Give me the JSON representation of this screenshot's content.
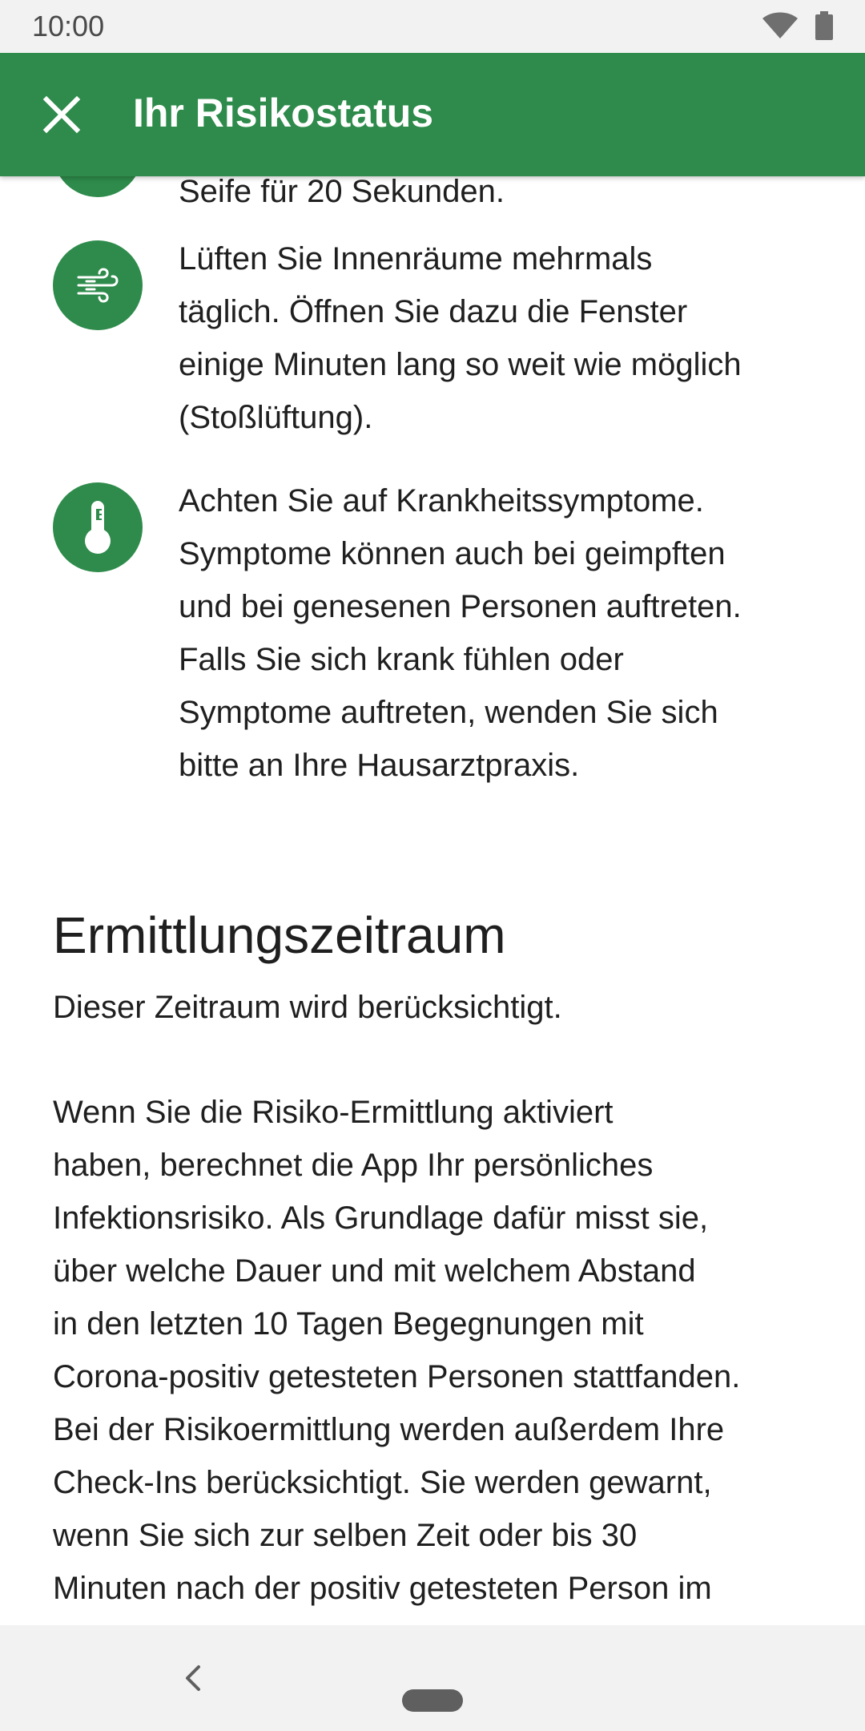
{
  "status_bar": {
    "time": "10:00"
  },
  "app_bar": {
    "title": "Ihr Risikostatus"
  },
  "tips": {
    "partial_text": "Seife für 20 Sekunden.",
    "ventilate": [
      "Lüften Sie Innenräume mehrmals",
      "täglich. Öffnen Sie dazu die Fenster",
      "einige Minuten lang so weit wie möglich",
      "(Stoßlüftung)."
    ],
    "symptoms": [
      "Achten Sie auf Krankheitssymptome.",
      "Symptome können auch bei geimpften",
      "und bei genesenen Personen auftreten.",
      "Falls Sie sich krank fühlen oder",
      "Symptome auftreten, wenden Sie sich",
      "bitte an Ihre Hausarztpraxis."
    ]
  },
  "section": {
    "title": "Ermittlungszeitraum",
    "subtitle": "Dieser Zeitraum wird berücksichtigt.",
    "body": [
      "Wenn Sie die Risiko-Ermittlung aktiviert",
      "haben, berechnet die App Ihr persönliches",
      "Infektionsrisiko. Als Grundlage dafür misst sie,",
      "über welche Dauer und mit welchem Abstand",
      "in den letzten 10 Tagen Begegnungen mit",
      "Corona-positiv getesteten Personen stattfanden.",
      "Bei der Risikoermittlung werden außerdem Ihre",
      "Check-Ins berücksichtigt. Sie werden gewarnt,",
      "wenn Sie sich zur selben Zeit oder bis 30",
      "Minuten nach der positiv getesteten Person im"
    ]
  },
  "icons": {
    "close": "close-icon",
    "wind": "wind-icon",
    "thermometer": "thermometer-icon",
    "wifi": "wifi-icon",
    "battery": "battery-icon",
    "back": "back-icon"
  },
  "colors": {
    "accent": "#2e8b4b"
  }
}
